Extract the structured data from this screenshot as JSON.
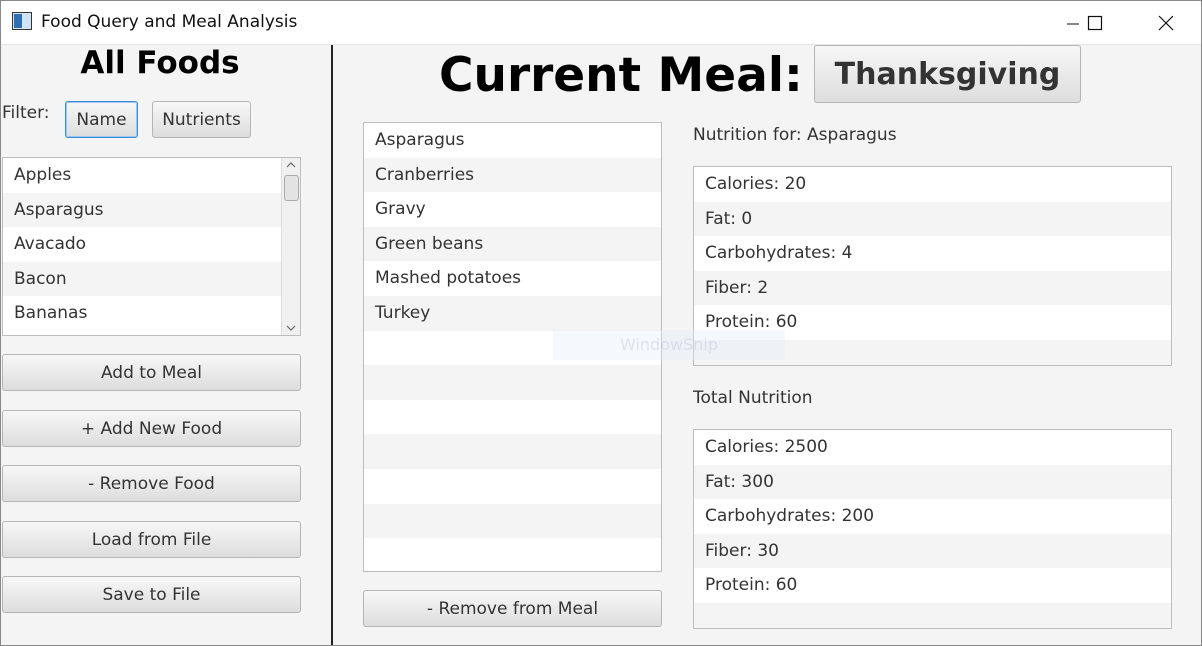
{
  "window": {
    "title": "Food Query and Meal Analysis",
    "minimize_icon": "minimize-icon",
    "maximize_icon": "maximize-icon",
    "close_icon": "close-icon"
  },
  "left": {
    "heading": "All Foods",
    "filter_label": "Filter:",
    "filter_buttons": [
      "Name",
      "Nutrients"
    ],
    "foods": [
      "Apples",
      "Asparagus",
      "Avacado",
      "Bacon",
      "Bananas"
    ],
    "actions": [
      "Add to Meal",
      "+ Add New Food",
      "- Remove Food",
      "Load from File",
      "Save to File"
    ]
  },
  "meal": {
    "heading": "Current Meal:",
    "name_button": "Thanksgiving",
    "items": [
      "Asparagus",
      "Cranberries",
      "Gravy",
      "Green beans",
      "Mashed potatoes",
      "Turkey"
    ],
    "remove_button": "- Remove from Meal"
  },
  "nutrition": {
    "selected_title": "Nutrition for: Asparagus",
    "selected": [
      "Calories: 20",
      "Fat: 0",
      "Carbohydrates: 4",
      "Fiber: 2",
      "Protein: 60"
    ],
    "total_title": "Total Nutrition",
    "total": [
      "Calories: 2500",
      "Fat: 300",
      "Carbohydrates: 200",
      "Fiber: 30",
      "Protein: 60"
    ]
  },
  "watermark": "WindowSnip",
  "colors": {
    "focus": "#3a8bd8",
    "divider": "#222222",
    "list_bg": "#ffffff",
    "alt_row": "#f4f4f4"
  }
}
